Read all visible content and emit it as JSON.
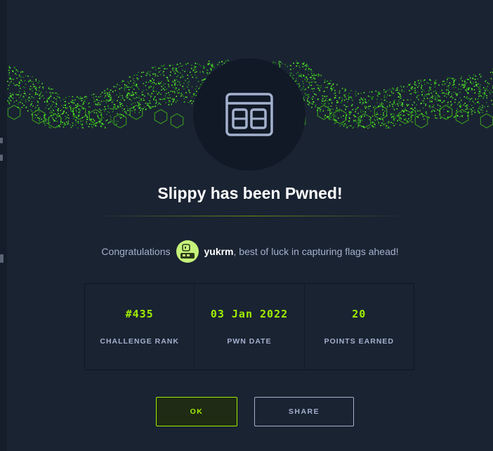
{
  "modal": {
    "title": "Slippy has been Pwned!",
    "icon": "browser-window-icon",
    "congrats_prefix": "Congratulations",
    "username": "yukrm",
    "congrats_suffix": ", best of luck in capturing flags ahead!",
    "user_avatar_icon": "robot-avatar-icon",
    "stats": [
      {
        "value": "#435",
        "label": "CHALLENGE RANK"
      },
      {
        "value": "03 Jan 2022",
        "label": "PWN DATE"
      },
      {
        "value": "20",
        "label": "POINTS EARNED"
      }
    ],
    "buttons": {
      "ok_label": "OK",
      "share_label": "SHARE"
    }
  },
  "colors": {
    "accent": "#9fef00",
    "background": "#1a2332",
    "text_muted": "#a4b1cd"
  }
}
